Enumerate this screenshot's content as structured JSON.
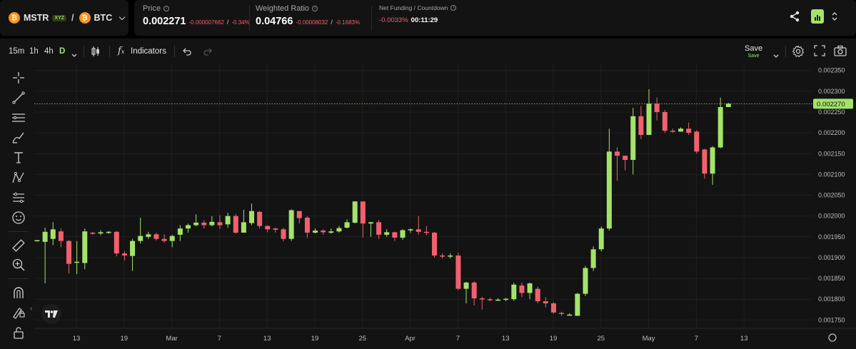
{
  "header": {
    "base_symbol": "MSTR",
    "base_badge": "XYZ",
    "separator": "/",
    "quote_symbol": "BTC",
    "price_label": "Price",
    "price_value": "0.002271",
    "price_change_abs": "-0.000007662",
    "price_change_sep": "/",
    "price_change_pct": "-0.34%",
    "ratio_label": "Weighted Ratio",
    "ratio_value": "0.04766",
    "ratio_change_abs": "-0.00008032",
    "ratio_change_sep": "/",
    "ratio_change_pct": "-0.1683%",
    "funding_label": "Net Funding / Countdown",
    "funding_value": "-0.0033%",
    "countdown_value": "00:11:29",
    "share_icon": "share-icon",
    "chart_type_icon": "bar-chart-icon"
  },
  "toolbar": {
    "timeframes": [
      "15m",
      "1h",
      "4h",
      "D"
    ],
    "active_timeframe": "D",
    "indicators_label": "Indicators",
    "save_label": "Save",
    "save_sub_label": "Save",
    "icons": [
      "candle-type-icon",
      "fx-icon",
      "undo-icon",
      "redo-icon",
      "settings-icon",
      "fullscreen-icon",
      "camera-icon"
    ]
  },
  "left_tools": [
    "crosshair-icon",
    "trend-line-icon",
    "horizontal-lines-icon",
    "brush-icon",
    "text-icon",
    "pattern-icon",
    "forecast-icon",
    "emoji-icon",
    "ruler-icon",
    "zoom-in-icon",
    "magnet-icon",
    "lock-drawing-icon",
    "lock-icon"
  ],
  "colors": {
    "up": "#a4e36b",
    "down": "#f0616d",
    "background": "#131313",
    "accent": "#a4e36b"
  },
  "chart_data": {
    "type": "candlestick",
    "current_price_label": "0.002270",
    "current_price": 0.00227,
    "y_ticks": [
      "0.002350",
      "0.002300",
      "0.002250",
      "0.002200",
      "0.002150",
      "0.002100",
      "0.002050",
      "0.002000",
      "0.001950",
      "0.001900",
      "0.001850",
      "0.001800",
      "0.001750"
    ],
    "x_ticks": [
      "13",
      "19",
      "Mar",
      "7",
      "13",
      "19",
      "25",
      "Apr",
      "7",
      "13",
      "19",
      "25",
      "May",
      "7",
      "13"
    ],
    "ylim": [
      0.00173,
      0.002365
    ],
    "grid": true,
    "candles": [
      [
        0.001942,
        0.001942,
        0.001942,
        0.001938
      ],
      [
        0.001938,
        0.001962,
        0.001972,
        0.001838
      ],
      [
        0.001945,
        0.001968,
        0.001985,
        0.00193
      ],
      [
        0.001963,
        0.00194,
        0.00197,
        0.001925
      ],
      [
        0.00194,
        0.001885,
        0.001942,
        0.001862
      ],
      [
        0.00189,
        0.00189,
        0.00194,
        0.00186
      ],
      [
        0.001887,
        0.001963,
        0.00197,
        0.001872
      ],
      [
        0.00196,
        0.001958,
        0.001962,
        0.001955
      ],
      [
        0.001958,
        0.001961,
        0.001966,
        0.001954
      ],
      [
        0.00196,
        0.001962,
        0.001964,
        0.001957
      ],
      [
        0.001962,
        0.00191,
        0.001964,
        0.001903
      ],
      [
        0.00191,
        0.001905,
        0.001916,
        0.001893
      ],
      [
        0.001904,
        0.00194,
        0.001945,
        0.001868
      ],
      [
        0.00194,
        0.001952,
        0.001996,
        0.001934
      ],
      [
        0.00195,
        0.001956,
        0.001962,
        0.001945
      ],
      [
        0.001956,
        0.001945,
        0.00196,
        0.001941
      ],
      [
        0.001945,
        0.00194,
        0.001956,
        0.001936
      ],
      [
        0.00194,
        0.001952,
        0.001955,
        0.001925
      ],
      [
        0.001955,
        0.00197,
        0.001978,
        0.00194
      ],
      [
        0.00197,
        0.001978,
        0.001982,
        0.00196
      ],
      [
        0.001978,
        0.001984,
        0.002004,
        0.001975
      ],
      [
        0.001984,
        0.001978,
        0.00199,
        0.00197
      ],
      [
        0.001978,
        0.001986,
        0.002,
        0.001975
      ],
      [
        0.001985,
        0.001978,
        0.002002,
        0.001969
      ],
      [
        0.00198,
        0.002,
        0.002008,
        0.001972
      ],
      [
        0.002,
        0.00196,
        0.002005,
        0.001957
      ],
      [
        0.00196,
        0.001985,
        0.002015,
        0.00196
      ],
      [
        0.001983,
        0.002012,
        0.00203,
        0.001978
      ],
      [
        0.00201,
        0.001976,
        0.002012,
        0.00197
      ],
      [
        0.001976,
        0.001968,
        0.001978,
        0.001961
      ],
      [
        0.00197,
        0.001967,
        0.001972,
        0.00196
      ],
      [
        0.001968,
        0.001945,
        0.001972,
        0.001939
      ],
      [
        0.001945,
        0.002014,
        0.002016,
        0.00194
      ],
      [
        0.002012,
        0.001995,
        0.002012,
        0.001982
      ],
      [
        0.001996,
        0.00196,
        0.002,
        0.001947
      ],
      [
        0.00196,
        0.001965,
        0.00197,
        0.001958
      ],
      [
        0.001965,
        0.001961,
        0.001968,
        0.001955
      ],
      [
        0.00196,
        0.001963,
        0.00197,
        0.001957
      ],
      [
        0.001963,
        0.001971,
        0.001976,
        0.00196
      ],
      [
        0.001972,
        0.001985,
        0.001992,
        0.00197
      ],
      [
        0.001984,
        0.002035,
        0.002036,
        0.001982
      ],
      [
        0.002035,
        0.001982,
        0.002035,
        0.001948
      ],
      [
        0.001982,
        0.001985,
        0.001986,
        0.00195
      ],
      [
        0.001985,
        0.001955,
        0.00199,
        0.001945
      ],
      [
        0.001955,
        0.001961,
        0.001968,
        0.00195
      ],
      [
        0.001961,
        0.001948,
        0.001962,
        0.00194
      ],
      [
        0.001948,
        0.001966,
        0.001968,
        0.001943
      ],
      [
        0.001966,
        0.001968,
        0.00197,
        0.00196
      ],
      [
        0.001968,
        0.001962,
        0.002,
        0.001955
      ],
      [
        0.001962,
        0.00196,
        0.001976,
        0.001954
      ],
      [
        0.00196,
        0.001905,
        0.001962,
        0.0019
      ],
      [
        0.001905,
        0.001903,
        0.00191,
        0.001898
      ],
      [
        0.001903,
        0.001905,
        0.00191,
        0.001898
      ],
      [
        0.001905,
        0.001825,
        0.001912,
        0.001822
      ],
      [
        0.001825,
        0.00184,
        0.001842,
        0.00179
      ],
      [
        0.00184,
        0.001802,
        0.001843,
        0.001785
      ],
      [
        0.001802,
        0.0018,
        0.001806,
        0.001775
      ],
      [
        0.0018,
        0.001799,
        0.001803,
        0.001795
      ],
      [
        0.001799,
        0.001799,
        0.001802,
        0.001796
      ],
      [
        0.001799,
        0.001801,
        0.001803,
        0.001795
      ],
      [
        0.0018,
        0.001835,
        0.00184,
        0.001796
      ],
      [
        0.001833,
        0.001815,
        0.00184,
        0.001805
      ],
      [
        0.001815,
        0.001838,
        0.00184,
        0.0018
      ],
      [
        0.001825,
        0.001795,
        0.00183,
        0.00179
      ],
      [
        0.001795,
        0.00179,
        0.001805,
        0.00178
      ],
      [
        0.00179,
        0.001768,
        0.001793,
        0.001765
      ],
      [
        0.001767,
        0.001765,
        0.00177,
        0.00176
      ],
      [
        0.001763,
        0.001763,
        0.001766,
        0.00176
      ],
      [
        0.00176,
        0.001813,
        0.001815,
        0.00176
      ],
      [
        0.001813,
        0.001875,
        0.00188,
        0.001808
      ],
      [
        0.001875,
        0.00192,
        0.001927,
        0.001868
      ],
      [
        0.00192,
        0.00197,
        0.001975,
        0.001915
      ],
      [
        0.00197,
        0.002155,
        0.00221,
        0.001965
      ],
      [
        0.002155,
        0.002145,
        0.002165,
        0.002085
      ],
      [
        0.002145,
        0.002135,
        0.002145,
        0.00211
      ],
      [
        0.002135,
        0.00224,
        0.00226,
        0.0021
      ],
      [
        0.00224,
        0.002195,
        0.002265,
        0.002185
      ],
      [
        0.002195,
        0.00227,
        0.002305,
        0.002195
      ],
      [
        0.00227,
        0.00225,
        0.002285,
        0.00223
      ],
      [
        0.00225,
        0.002205,
        0.002255,
        0.0022
      ],
      [
        0.002205,
        0.002203,
        0.00221,
        0.0022
      ],
      [
        0.002203,
        0.00221,
        0.002213,
        0.002203
      ],
      [
        0.00221,
        0.0022,
        0.002225,
        0.002195
      ],
      [
        0.002203,
        0.002155,
        0.002206,
        0.00215
      ],
      [
        0.00216,
        0.002102,
        0.002162,
        0.00209
      ],
      [
        0.002102,
        0.002165,
        0.002168,
        0.002075
      ],
      [
        0.002165,
        0.002262,
        0.002285,
        0.002163
      ],
      [
        0.002262,
        0.00227,
        0.002272,
        0.002262
      ]
    ]
  }
}
